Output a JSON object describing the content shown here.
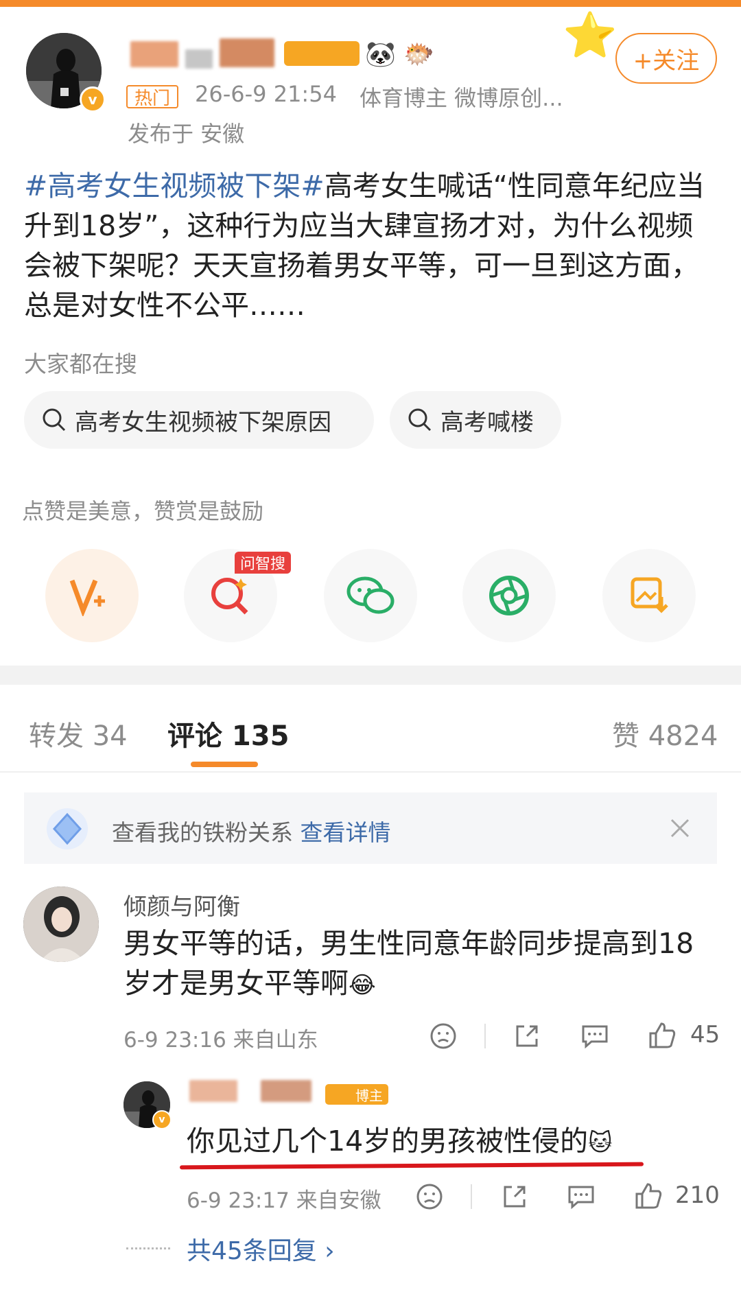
{
  "post": {
    "hot_tag": "热门",
    "timestamp": "26-6-9 21:54",
    "author_desc": "体育博主 微博原创...",
    "location": "发布于 安徽",
    "follow_label": "+关注",
    "topic": "#高考女生视频被下架#",
    "body": "高考女生喊话“性同意年纪应当升到18岁”，这种行为应当大肆宣扬才对，为什么视频会被下架呢？天天宣扬着男女平等，可一旦到这方面，总是对女性不公平……"
  },
  "search": {
    "label": "大家都在搜",
    "chips": [
      "高考女生视频被下架原因",
      "高考喊楼"
    ]
  },
  "reward": {
    "label": "点赞是美意，赞赏是鼓励",
    "ask_badge": "问智搜"
  },
  "tabs": {
    "repost": "转发 34",
    "comments": "评论 135",
    "likes": "赞 4824"
  },
  "fan_bar": {
    "text": "查看我的铁粉关系",
    "link": "查看详情"
  },
  "comment1": {
    "name": "倾颜与阿衡",
    "text": "男女平等的话，男生性同意年龄同步提高到18岁才是男女平等啊",
    "emoji": "😂",
    "meta": "6-9 23:16 来自山东",
    "likes": "45"
  },
  "reply1": {
    "badge": "博主",
    "text": "你见过几个14岁的男孩被性侵的",
    "emoji": "🐱",
    "meta": "6-9 23:17 来自安徽",
    "likes": "210"
  },
  "more_replies": "共45条回复 ›",
  "colors": {
    "accent": "#f58a2a",
    "link": "#3d6aa8",
    "underline_red": "#d8171c"
  }
}
